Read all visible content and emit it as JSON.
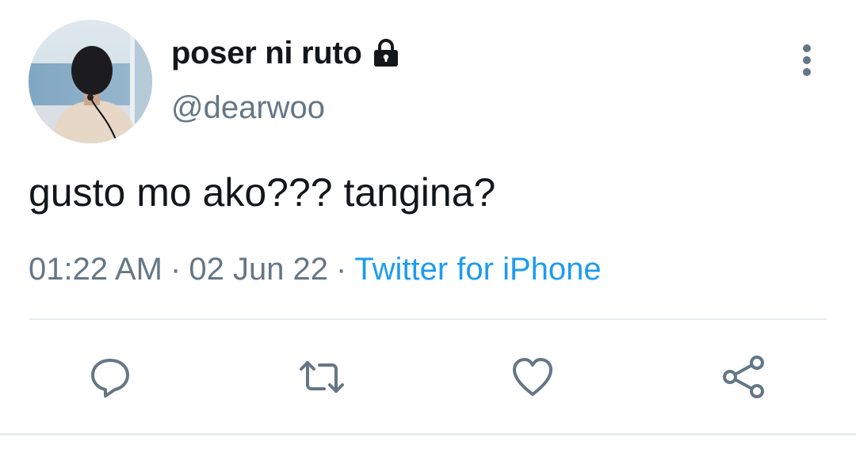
{
  "tweet": {
    "display_name": "poser ni ruto",
    "handle": "@dearwoo",
    "protected": true,
    "text": "gusto mo ako??? tangina?",
    "time": "01:22 AM",
    "separator": "·",
    "date": "02 Jun 22",
    "source": "Twitter for iPhone"
  },
  "icons": {
    "lock": "lock-icon",
    "more": "more-vertical-icon",
    "reply": "reply-icon",
    "retweet": "retweet-icon",
    "like": "heart-icon",
    "share": "share-icon"
  },
  "colors": {
    "text_primary": "#14171a",
    "text_secondary": "#657786",
    "link": "#1d9bf0",
    "divider": "#e6ecf0"
  }
}
